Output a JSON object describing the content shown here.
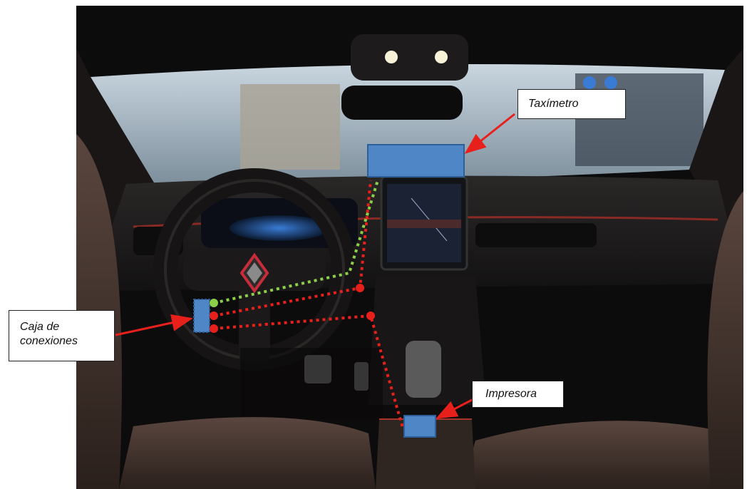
{
  "labels": {
    "taximetro": "Taxímetro",
    "impresora": "Impresora",
    "caja_line1": "Caja de",
    "caja_line2": "conexiones"
  },
  "colors": {
    "device_fill": "#4f86c6",
    "device_stroke": "#2f5f9a",
    "power_wire": "#e8201c",
    "signal_wire": "#8cd04a",
    "arrow": "#e8201c",
    "dashboard": "#1c1a1a",
    "seat_leather": "#3a2d28"
  },
  "icons": [
    "steering-wheel",
    "renault-logo",
    "touchscreen",
    "gear-shifter",
    "pedals"
  ]
}
